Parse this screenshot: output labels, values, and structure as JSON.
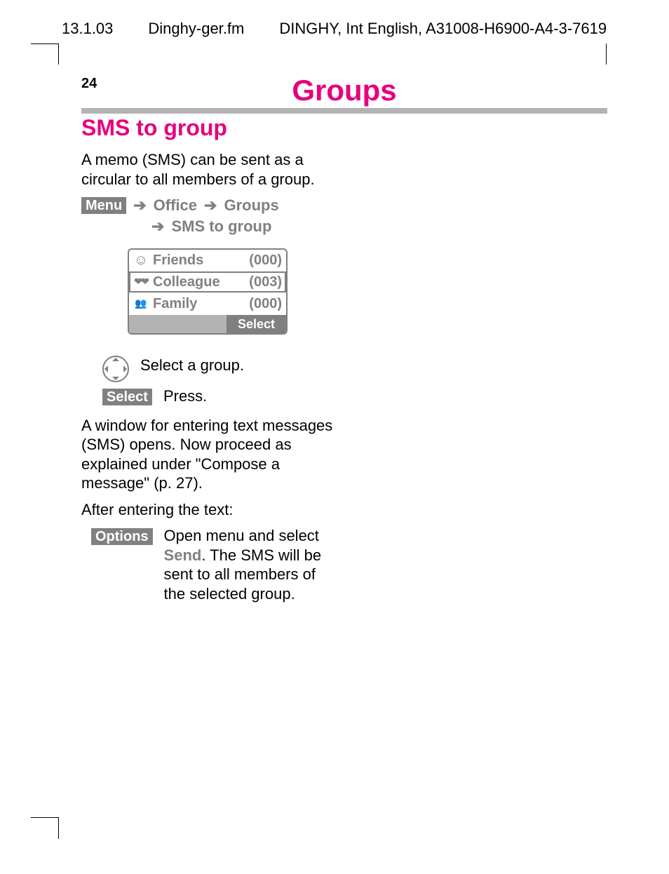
{
  "doc_header": {
    "date": "13.1.03",
    "filename": "Dinghy-ger.fm",
    "doc_id": "DINGHY, Int English, A31008-H6900-A4-3-7619"
  },
  "page_number": "24",
  "chapter_title": "Groups",
  "section_title": "SMS to group",
  "intro_para": "A memo (SMS) can be sent as a circular to all members of a group.",
  "breadcrumb": {
    "menu_label": "Menu",
    "level1": "Office",
    "level2": "Groups",
    "level3": "SMS to group"
  },
  "phone_screen": {
    "rows": [
      {
        "icon": "smiley-icon",
        "glyph": "☺",
        "name": "Friends",
        "count": "(000)",
        "selected": false
      },
      {
        "icon": "hearts-icon",
        "glyph": "❤︎",
        "name": "Colleague",
        "count": "(003)",
        "selected": true
      },
      {
        "icon": "people-icon",
        "glyph": "👥",
        "name": "Family",
        "count": "(000)",
        "selected": false
      }
    ],
    "softkey_right": "Select"
  },
  "instructions": {
    "nav_text": "Select a group.",
    "select_label": "Select",
    "press_text": "Press."
  },
  "para2": "A window for entering text messages (SMS) opens. Now proceed as explained under \"Compose a message\" (p. 27).",
  "para3": "After entering the text:",
  "options_block": {
    "options_label": "Options",
    "text_prefix": "Open menu and select ",
    "send_label": "Send",
    "text_suffix": ". The SMS will be sent to all members of the selected group."
  }
}
